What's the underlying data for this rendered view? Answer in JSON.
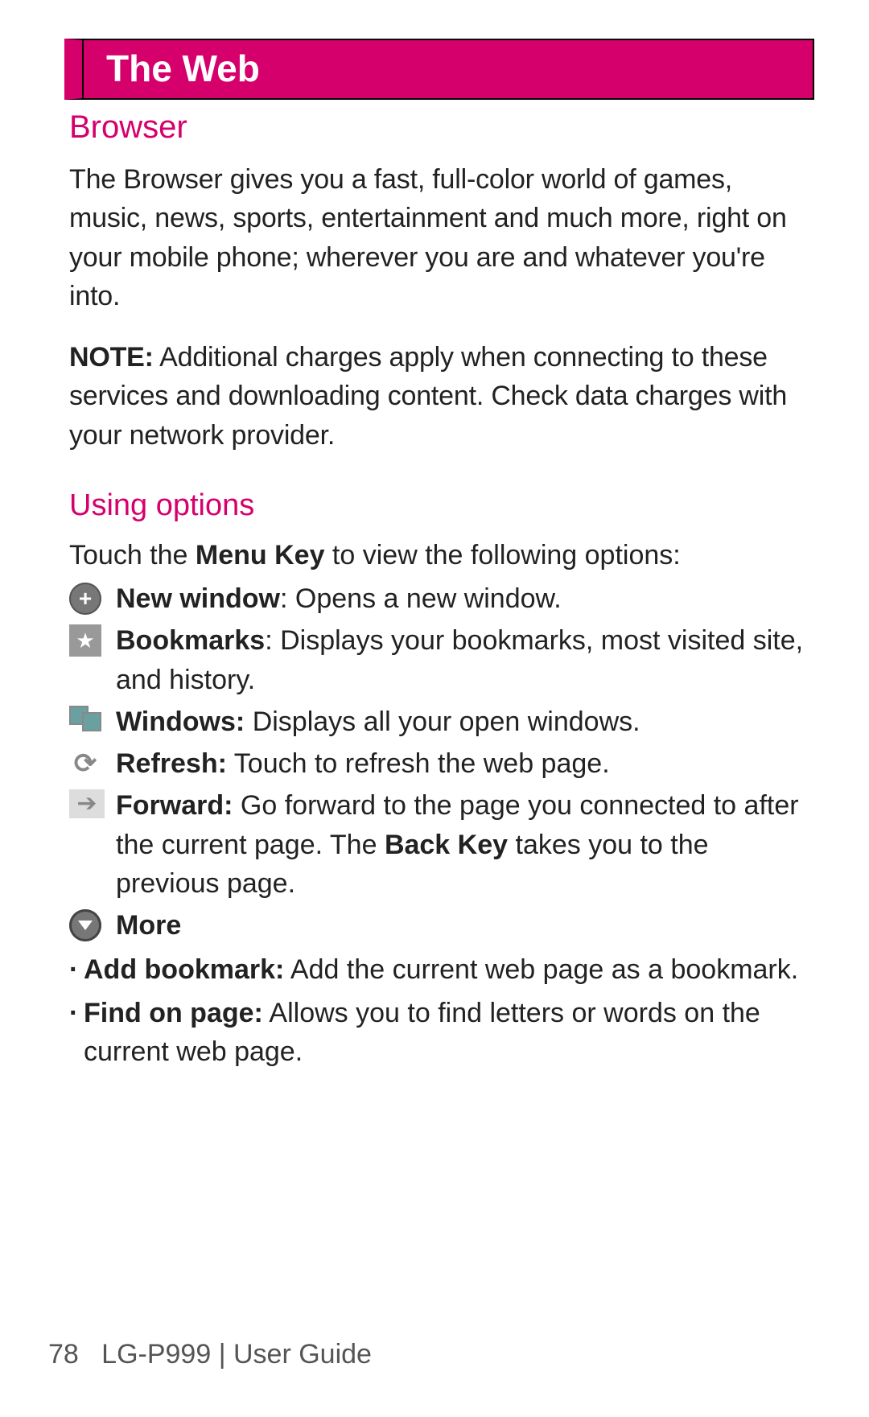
{
  "header": {
    "title": "The Web"
  },
  "section1": {
    "heading": "Browser",
    "para1": "The Browser gives you a fast, full-color world of games, music, news, sports, entertainment and much more, right on your mobile phone; wherever you are and whatever you're into.",
    "note_label": "NOTE:",
    "note_text": " Additional charges apply when connecting to these services and downloading content. Check data charges with your network provider."
  },
  "section2": {
    "heading": "Using options",
    "intro_pre": "Touch the ",
    "intro_bold": "Menu Key",
    "intro_post": " to view the following options:",
    "items": [
      {
        "icon": "new-window-icon",
        "label": "New window",
        "sep": ": ",
        "desc": "Opens a new window."
      },
      {
        "icon": "bookmark-icon",
        "label": "Bookmarks",
        "sep": ": ",
        "desc": "Displays your bookmarks, most visited site, and history."
      },
      {
        "icon": "windows-icon",
        "label": "Windows:",
        "sep": " ",
        "desc": "Displays all your open windows."
      },
      {
        "icon": "refresh-icon",
        "label": "Refresh:",
        "sep": " ",
        "desc": "Touch to refresh the web page."
      },
      {
        "icon": "forward-icon",
        "label": "Forward:",
        "sep": " ",
        "desc_pre": "Go forward to the page you connected to after the current page. The ",
        "desc_bold": "Back Key",
        "desc_post": " takes you to the previous page."
      },
      {
        "icon": "more-icon",
        "label": "More",
        "sep": "",
        "desc": ""
      }
    ],
    "bullets": [
      {
        "label": "Add bookmark:",
        "desc": " Add the current web page as a bookmark."
      },
      {
        "label": "Find on page:",
        "desc": " Allows you to find letters or words on the current web page."
      }
    ]
  },
  "footer": {
    "page_num": "78",
    "model": "LG-P999",
    "separator": "  |  ",
    "doc": "User Guide"
  }
}
